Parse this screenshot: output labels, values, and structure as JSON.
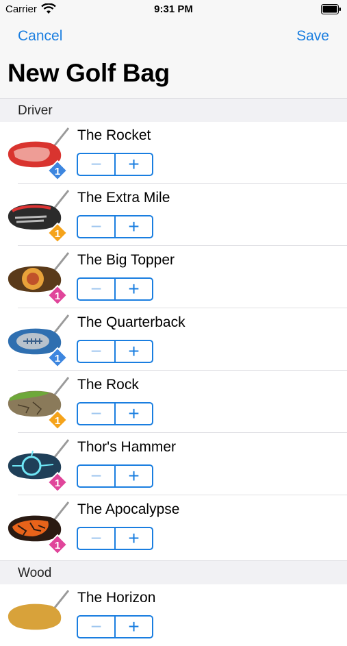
{
  "status": {
    "carrier": "Carrier",
    "time": "9:31 PM"
  },
  "nav": {
    "cancel": "Cancel",
    "save": "Save",
    "title": "New Golf Bag"
  },
  "sections": {
    "driver": "Driver",
    "wood": "Wood"
  },
  "stepper": {
    "minus": "−",
    "plus": "+"
  },
  "colors": {
    "accent": "#1a7ee0",
    "badge_blue": "#3d86df",
    "badge_orange": "#f5a31a",
    "badge_pink": "#e0459a"
  },
  "clubs": [
    {
      "name": "The Rocket",
      "badge": "1",
      "badge_color": "blue"
    },
    {
      "name": "The Extra Mile",
      "badge": "1",
      "badge_color": "orange"
    },
    {
      "name": "The Big Topper",
      "badge": "1",
      "badge_color": "pink"
    },
    {
      "name": "The Quarterback",
      "badge": "1",
      "badge_color": "blue"
    },
    {
      "name": "The Rock",
      "badge": "1",
      "badge_color": "orange"
    },
    {
      "name": "Thor's Hammer",
      "badge": "1",
      "badge_color": "pink"
    },
    {
      "name": "The Apocalypse",
      "badge": "1",
      "badge_color": "pink"
    },
    {
      "name": "The Horizon"
    }
  ]
}
